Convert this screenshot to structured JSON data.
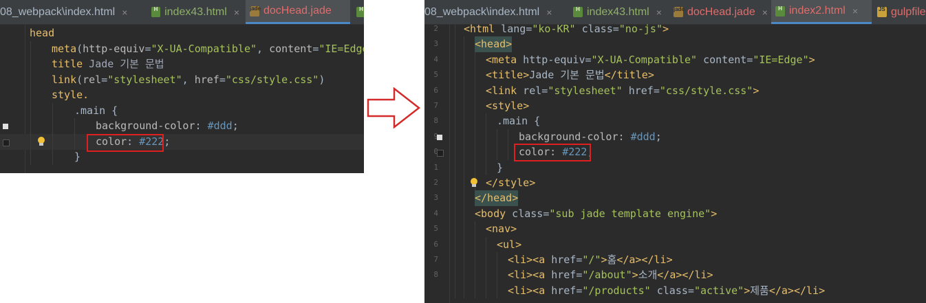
{
  "left_editor": {
    "tabs": [
      {
        "label": "08_webpack\\index.html",
        "icon": "html-file-icon",
        "active": false,
        "color": "#a9b7c6"
      },
      {
        "label": "index43.html",
        "icon": "html-file-icon",
        "active": false,
        "color": "#8fb06a"
      },
      {
        "label": "docHead.jade",
        "icon": "jade-file-icon",
        "active": true,
        "color": "#e06c6c"
      }
    ],
    "lines": [
      {
        "t1": "head"
      },
      {
        "kw": "meta",
        "open": "(",
        "a1": "http-equiv",
        "eq1": "=",
        "s1": "\"X-UA-Compatible\"",
        "comma": ", ",
        "a2": "content",
        "eq2": "=",
        "s2": "\"IE=Edge\"",
        "close": ")"
      },
      {
        "kw": "title",
        "rest": " Jade 기본 문법"
      },
      {
        "kw": "link",
        "open": "(",
        "a1": "rel",
        "eq1": "=",
        "s1": "\"stylesheet\"",
        "comma": ", ",
        "a2": "href",
        "eq2": "=",
        "s2": "\"css/style.css\"",
        "close": ")"
      },
      {
        "kw": "style."
      },
      {
        "sel": ".main {"
      },
      {
        "prop": "background-color",
        "colon": ": ",
        "val": "#ddd",
        "semi": ";"
      },
      {
        "prop": "color",
        "colon": ": ",
        "val": "#222",
        "semi": ";"
      },
      {
        "close": "}"
      }
    ]
  },
  "right_editor": {
    "tabs": [
      {
        "label": "08_webpack\\index.html",
        "icon": "html-file-icon",
        "active": false,
        "color": "#a9b7c6"
      },
      {
        "label": "index43.html",
        "icon": "html-file-icon",
        "active": false,
        "color": "#8fb06a"
      },
      {
        "label": "docHead.jade",
        "icon": "jade-file-icon",
        "active": false,
        "color": "#e06c6c"
      },
      {
        "label": "index2.html",
        "icon": "html-file-icon",
        "active": true,
        "color": "#e06c6c"
      },
      {
        "label": "gulpfile",
        "icon": "js-file-icon",
        "active": false,
        "color": "#e06c6c"
      }
    ],
    "line_numbers": [
      "2",
      "3",
      "4",
      "5",
      "6",
      "7",
      "8",
      "9",
      "0",
      "1",
      "2",
      "3",
      "4",
      "5",
      "6",
      "7",
      "8"
    ],
    "lines": [
      "<html lang=\"ko-KR\" class=\"no-js\">",
      "<head>",
      "<meta http-equiv=\"X-UA-Compatible\" content=\"IE=Edge\">",
      "<title>Jade 기본 문법</title>",
      "<link rel=\"stylesheet\" href=\"css/style.css\">",
      "<style>",
      ".main {",
      "background-color: #ddd;",
      "color: #222;",
      "}",
      "</style>",
      "</head>",
      "<body class=\"sub jade template engine\">",
      "<nav>",
      "<ul>",
      "<li><a href=\"/\">홈</a></li>",
      "<li><a href=\"/about\">소개</a></li>",
      "<li><a href=\"/products\" class=\"active\">제품</a></li>"
    ]
  },
  "colors": {
    "editor_bg": "#2b2b2b",
    "tag": "#e8bf6a",
    "string": "#a5c25c",
    "keyword": "#cc7832",
    "number": "#6897bb",
    "highlight_box": "#e02020",
    "arrow": "#d42a2a"
  }
}
